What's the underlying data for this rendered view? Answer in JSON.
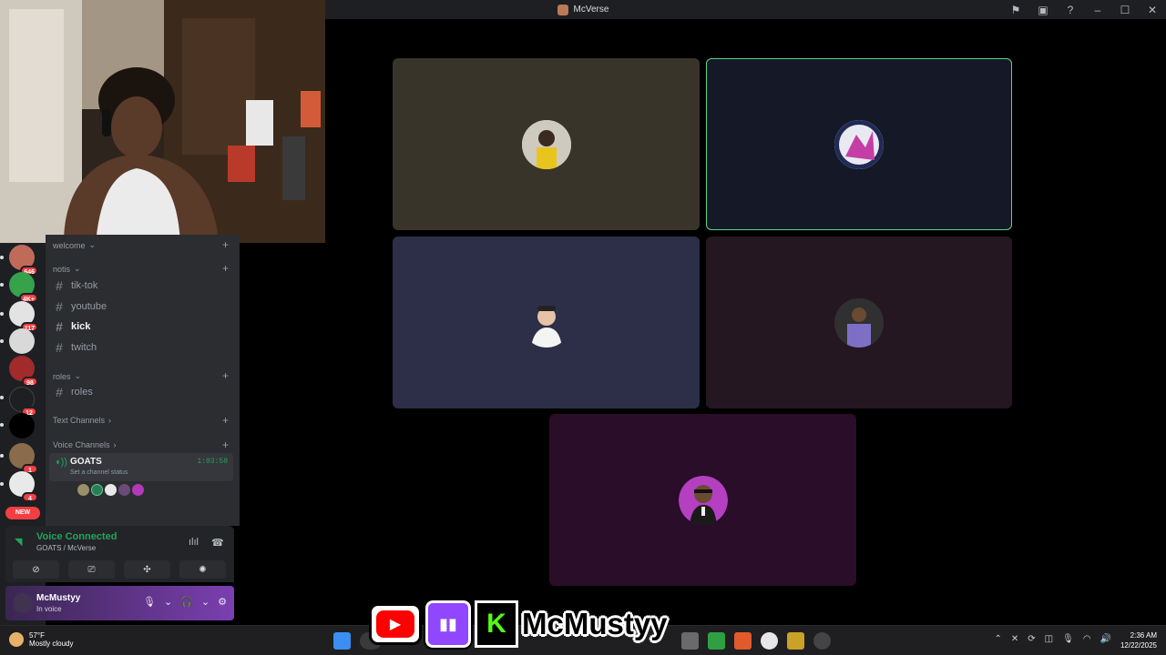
{
  "window": {
    "title": "McVerse"
  },
  "sidebar": {
    "categories": {
      "welcome": "welcome",
      "notis": "notis",
      "roles": "roles",
      "text": "Text Channels",
      "voice": "Voice Channels"
    },
    "channels": [
      "tik-tok",
      "youtube",
      "kick",
      "twitch"
    ],
    "roles_channel": "roles",
    "active_channel": "kick",
    "voice_channel": {
      "name": "GOATS",
      "time": "1:03:58",
      "status": "Set a channel status"
    }
  },
  "guild_badges": [
    "646",
    "4K+",
    "117",
    "98",
    "12",
    "1",
    "4"
  ],
  "new_badge": "NEW",
  "voice_panel": {
    "title": "Voice Connected",
    "subtitle": "GOATS / McVerse"
  },
  "user": {
    "name": "McMustyy",
    "status": "In voice"
  },
  "weather": {
    "temp": "57°F",
    "desc": "Mostly cloudy"
  },
  "clock": {
    "time": "2:36 AM",
    "date": "12/22/2025"
  },
  "overlay": {
    "name": "McMustyy"
  },
  "colors": {
    "tile1": "#39342a",
    "tile2": "#141827",
    "tile3": "#2c2f47",
    "tile4": "#251722",
    "tile5": "#2a0d29",
    "speaking": "#5bd48a"
  }
}
